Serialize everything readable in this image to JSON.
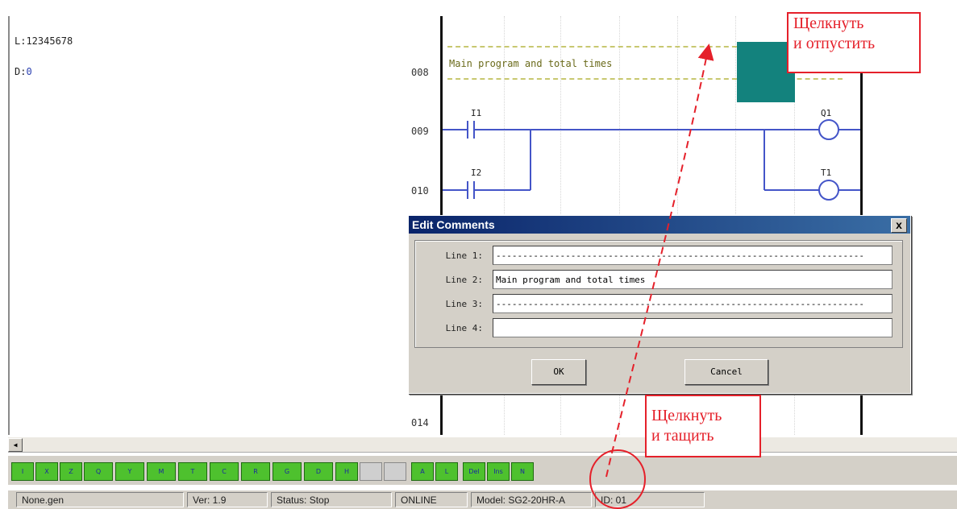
{
  "info": {
    "l_label": "L:",
    "l_value": "12345678",
    "d_label": "D:",
    "d_value": "0"
  },
  "ladder": {
    "rungs": [
      "008",
      "009",
      "010",
      "014"
    ],
    "comment": "Main program and total times",
    "contacts": [
      "I1",
      "I2"
    ],
    "coils": [
      "Q1",
      "T1"
    ]
  },
  "dialog": {
    "title": "Edit Comments",
    "close": "x",
    "lines": [
      {
        "label": "Line 1:",
        "value": "---------------------------------------------------------------------"
      },
      {
        "label": "Line 2:",
        "value": "Main program and total times"
      },
      {
        "label": "Line 3:",
        "value": "---------------------------------------------------------------------"
      },
      {
        "label": "Line 4:",
        "value": ""
      }
    ],
    "ok": "OK",
    "cancel": "Cancel"
  },
  "scroll": {
    "left_arrow": "◀"
  },
  "toolbar": {
    "buttons": [
      "I",
      "X",
      "Z",
      "Q",
      "Y",
      "M",
      "T",
      "C",
      "R",
      "G",
      "D",
      "H",
      "",
      "",
      "A",
      "L",
      "Del",
      "Ins",
      "N"
    ]
  },
  "status": {
    "file": "None.gen",
    "version": "Ver: 1.9",
    "state": "Status: Stop",
    "mode": "ONLINE",
    "model": "Model: SG2-20HR-A",
    "id": "ID: 01"
  },
  "annotations": {
    "release": [
      "Щелкнуть",
      "и отпустить"
    ],
    "drag": [
      "Щелкнуть",
      "и тащить"
    ],
    "color": "#e5202a"
  }
}
